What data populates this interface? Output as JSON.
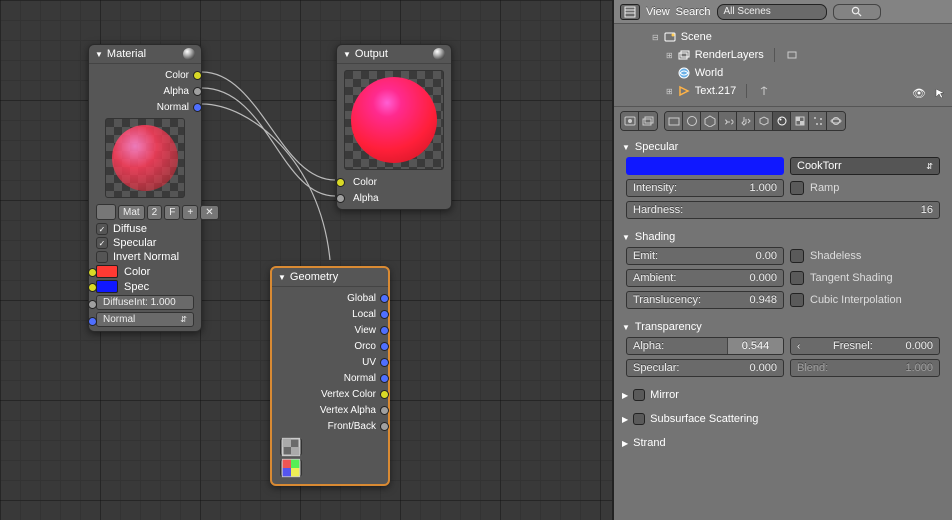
{
  "nodes": {
    "material": {
      "title": "Material",
      "outputs": [
        "Color",
        "Alpha",
        "Normal"
      ],
      "mat_row": {
        "name": "Mat",
        "users": "2",
        "fbtn": "F",
        "plus": "+",
        "x": "✕"
      },
      "checks": [
        {
          "label": "Diffuse",
          "checked": true
        },
        {
          "label": "Specular",
          "checked": true
        },
        {
          "label": "Invert Normal",
          "checked": false
        }
      ],
      "inputs": {
        "color_label": "Color",
        "spec_label": "Spec"
      },
      "diffuse_int": "DiffuseInt: 1.000",
      "normal_label": "Normal "
    },
    "output": {
      "title": "Output",
      "inputs": [
        "Color",
        "Alpha"
      ]
    },
    "geometry": {
      "title": "Geometry",
      "outputs": [
        "Global",
        "Local",
        "View",
        "Orco",
        "UV",
        "Normal",
        "Vertex Color",
        "Vertex Alpha",
        "Front/Back"
      ]
    }
  },
  "headerbar": {
    "view": "View",
    "search": "Search",
    "scenes_selector": "All Scenes"
  },
  "outliner": {
    "scene": "Scene",
    "renderlayers": "RenderLayers",
    "world": "World",
    "text": "Text.217"
  },
  "panels": {
    "specular": {
      "title": "Specular",
      "model": "CookTorr",
      "intensity": {
        "label": "Intensity:",
        "value": "1.000"
      },
      "ramp_label": "Ramp",
      "hardness": {
        "label": "Hardness:",
        "value": "16"
      }
    },
    "shading": {
      "title": "Shading",
      "emit": {
        "label": "Emit:",
        "value": "0.00"
      },
      "ambient": {
        "label": "Ambient:",
        "value": "0.000"
      },
      "translucency": {
        "label": "Translucency:",
        "value": "0.948"
      },
      "shadeless": "Shadeless",
      "tangent": "Tangent Shading",
      "cubic": "Cubic Interpolation"
    },
    "transparency": {
      "title": "Transparency",
      "alpha": {
        "label": "Alpha:",
        "value": "0.544"
      },
      "specular": {
        "label": "Specular:",
        "value": "0.000"
      },
      "fresnel": {
        "label": "Fresnel:",
        "value": "0.000"
      },
      "blend": {
        "label": "Blend:",
        "value": "1.000"
      }
    },
    "mirror": {
      "title": "Mirror"
    },
    "sss": {
      "title": "Subsurface Scattering"
    },
    "strand": {
      "title": "Strand"
    }
  }
}
